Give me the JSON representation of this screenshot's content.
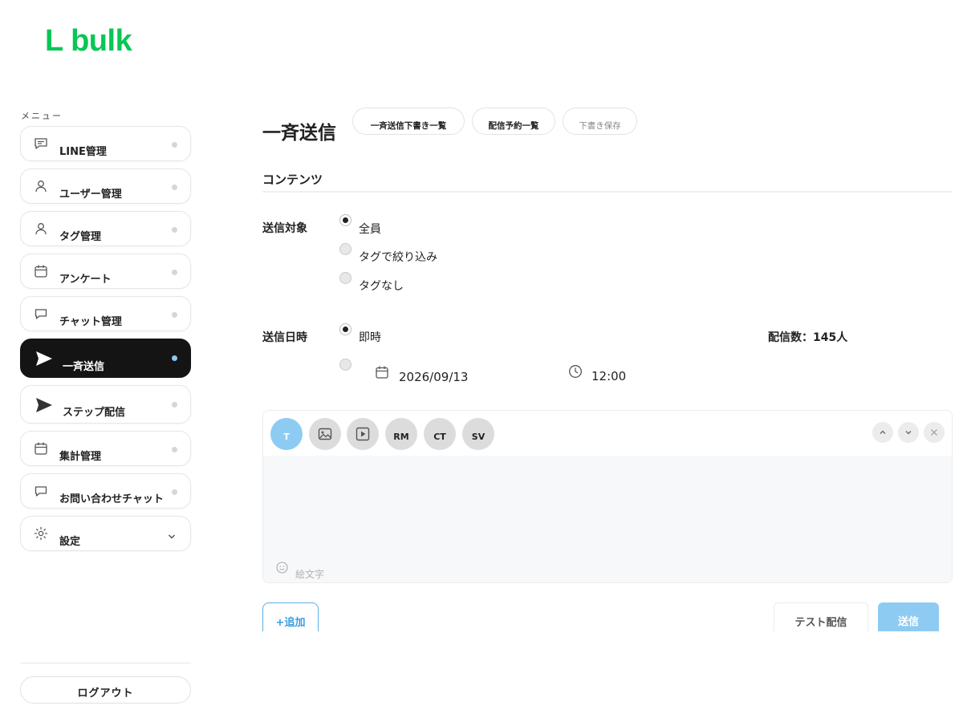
{
  "brand": {
    "logo_text": "L bulk",
    "color": "#06c755"
  },
  "sidebar": {
    "menu_label": "メニュー",
    "items": [
      {
        "label": "LINE管理",
        "icon": "chat-bubble-icon"
      },
      {
        "label": "ユーザー管理",
        "icon": "person-icon"
      },
      {
        "label": "タグ管理",
        "icon": "person-icon"
      },
      {
        "label": "アンケート",
        "icon": "calendar-icon"
      },
      {
        "label": "チャット管理",
        "icon": "chat-bubble-icon"
      },
      {
        "label": "一斉送信",
        "icon": "send-icon",
        "active": true
      },
      {
        "label": "ステップ配信",
        "icon": "send-icon"
      },
      {
        "label": "集計管理",
        "icon": "calendar-icon"
      },
      {
        "label": "お問い合わせチャット",
        "icon": "chat-bubble-icon"
      },
      {
        "label": "設定",
        "icon": "gear-icon"
      }
    ],
    "logout_label": "ログアウト"
  },
  "header": {
    "title": "一斉送信",
    "buttons": [
      "一斉送信下書き一覧",
      "配信予約一覧",
      "下書き保存"
    ]
  },
  "content": {
    "section_title": "コンテンツ",
    "target": {
      "label": "送信対象",
      "options": [
        "全員",
        "タグで絞り込み",
        "タグなし"
      ],
      "selected": "全員"
    },
    "schedule": {
      "label": "送信日時",
      "immediate_label": "即時",
      "selected": "即時",
      "date": "2026/09/13",
      "time": "12:00"
    },
    "delivery_count": "配信数：145人"
  },
  "editor": {
    "tools": [
      "T",
      "image",
      "video",
      "RM",
      "CT",
      "SV"
    ],
    "emoji_label": "絵文字"
  },
  "footer": {
    "add_label": "+追加",
    "test_label": "テスト配信",
    "send_label": "送信"
  },
  "colors": {
    "accent": "#8ecbf3",
    "active_bg": "#141414"
  }
}
